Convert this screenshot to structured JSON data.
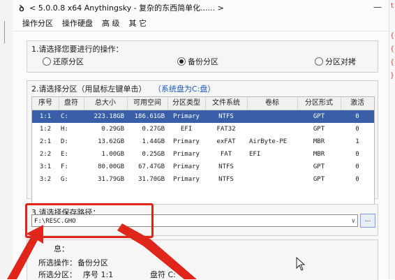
{
  "window": {
    "title": "< 5.0.0.8 x64 Anythingsky - 复杂的东西简单化...... >",
    "controls": "—"
  },
  "menu": [
    "操作分区",
    "操作硬盘",
    "高 级",
    "其 它"
  ],
  "operation": {
    "label": "1.请选择您要进行的操作：",
    "options": [
      {
        "label": "还原分区",
        "checked": false
      },
      {
        "label": "备份分区",
        "checked": true
      },
      {
        "label": "分区对拷",
        "checked": false
      }
    ]
  },
  "partition": {
    "label": "2.请选择分区（用鼠标左键单击）",
    "system_note": "（系统盘为C:盘）",
    "columns": [
      "序号",
      "盘符",
      "总大小",
      "可用空间",
      "分区类型",
      "文件系统",
      "卷标",
      "分区形式",
      "激活"
    ],
    "rows": [
      {
        "no": "1:1",
        "drive": "C:",
        "total": "223.18GB",
        "free": "186.61GB",
        "type": "Primary",
        "fs": "NTFS",
        "label": "",
        "form": "GPT",
        "active": "0",
        "selected": true
      },
      {
        "no": "1:2",
        "drive": "H:",
        "total": "0.29GB",
        "free": "0.27GB",
        "type": "EFI",
        "fs": "FAT32",
        "label": "",
        "form": "GPT",
        "active": "0",
        "selected": false
      },
      {
        "no": "2:1",
        "drive": "D:",
        "total": "13.62GB",
        "free": "1.44GB",
        "type": "Primary",
        "fs": "exFAT",
        "label": "AirByte-PE",
        "form": "MBR",
        "active": "1",
        "selected": false
      },
      {
        "no": "2:2",
        "drive": "E:",
        "total": "1.00GB",
        "free": "0.25GB",
        "type": "Primary",
        "fs": "FAT",
        "label": "EFI",
        "form": "MBR",
        "active": "0",
        "selected": false
      },
      {
        "no": "3:1",
        "drive": "F:",
        "total": "80.00GB",
        "free": "67.47GB",
        "type": "Primary",
        "fs": "NTFS",
        "label": "",
        "form": "GPT",
        "active": "0",
        "selected": false
      },
      {
        "no": "3:2",
        "drive": "G:",
        "total": "31.79GB",
        "free": "31.70GB",
        "type": "Primary",
        "fs": "NTFS",
        "label": "",
        "form": "GPT",
        "active": "0",
        "selected": false
      }
    ]
  },
  "save": {
    "label": "3.请选择保存路径：",
    "path": "F:\\RESC.GHO",
    "browse": "..."
  },
  "summary": {
    "partial_label": "息：",
    "operation_label": "所选操作：",
    "operation_value": "备份分区",
    "partition_label": "所选分区：",
    "no_label": "序号 1:1",
    "drive_label": "盘符 C:"
  },
  "side_marks": [
    "t",
    "{",
    "{",
    "{",
    "}"
  ],
  "colors": {
    "accent": "#3b5ea8",
    "highlight": "#e0261b",
    "link": "#1a56c9"
  }
}
